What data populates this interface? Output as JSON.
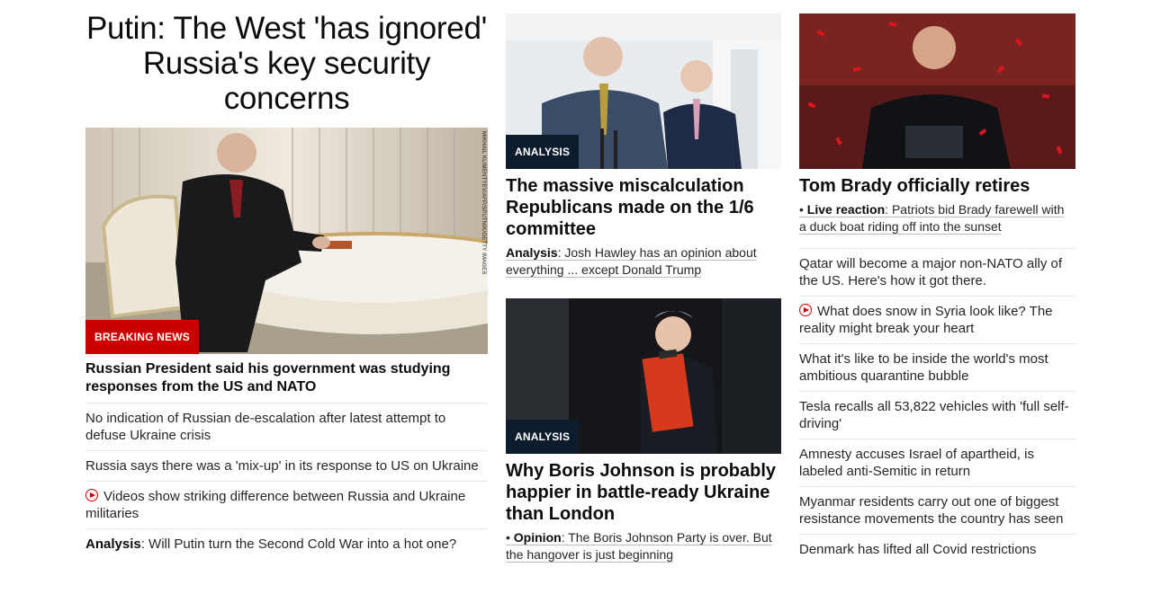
{
  "main_story": {
    "headline": "Putin: The West 'has ignored' Russia's key security concerns",
    "photo_credit": "MIKHAIL KLIMENTYEV/AFP/SPUTNIK/GETTY IMAGES",
    "badge": "BREAKING NEWS",
    "lead": "Russian President said his government was studying responses from the US and NATO",
    "related": [
      {
        "text": "No indication of Russian de-escalation after latest attempt to defuse Ukraine crisis"
      },
      {
        "text": "Russia says there was a 'mix-up' in its response to US on Ukraine"
      },
      {
        "text": "Videos show striking difference between Russia and Ukraine militaries",
        "icon": "play-icon"
      },
      {
        "prefix": "Analysis",
        "text": ": Will Putin turn the Second Cold War into a hot one?"
      }
    ]
  },
  "story_gop": {
    "badge": "ANALYSIS",
    "headline": "The massive miscalculation Republicans made on the 1/6 committee",
    "sub_prefix": "Analysis",
    "sub_text": ": Josh Hawley has an opinion about everything ... except Donald Trump"
  },
  "story_boris": {
    "badge": "ANALYSIS",
    "headline": "Why Boris Johnson is probably happier in battle-ready Ukraine than London",
    "sub_prefix": "Opinion",
    "sub_text": ": The Boris Johnson Party is over. But the hangover is just beginning"
  },
  "story_brady": {
    "headline": "Tom Brady officially retires",
    "sub_prefix": "Live reaction",
    "sub_text": ": Patriots bid Brady farewell with a duck boat riding off into the sunset",
    "list": [
      {
        "text": "Qatar will become a major non-NATO ally of the US. Here's how it got there."
      },
      {
        "text": "What does snow in Syria look like? The reality might break your heart",
        "icon": "play-icon"
      },
      {
        "text": "What it's like to be inside the world's most ambitious quarantine bubble"
      },
      {
        "text": "Tesla recalls all 53,822 vehicles with 'full self-driving'"
      },
      {
        "text": "Amnesty accuses Israel of apartheid, is labeled anti-Semitic in return"
      },
      {
        "text": "Myanmar residents carry out one of biggest resistance movements the country has seen"
      },
      {
        "text": "Denmark has lifted all Covid restrictions"
      }
    ]
  },
  "colors": {
    "breaking": "#cc0000",
    "analysis_badge": "#0c1c2c",
    "text": "#262626"
  }
}
